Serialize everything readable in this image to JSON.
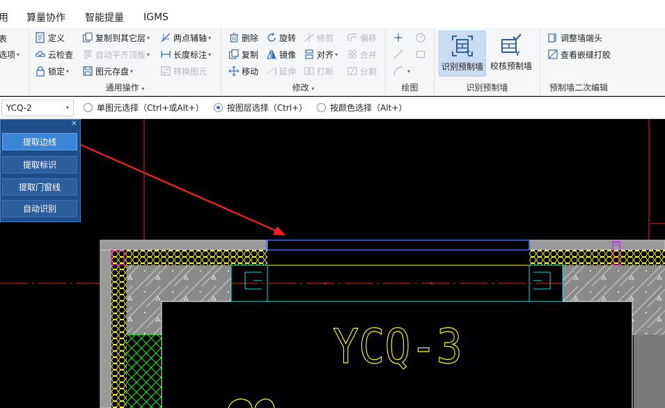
{
  "menubar": {
    "items": [
      "用",
      "算量协作",
      "智能提量",
      "IGMS"
    ]
  },
  "ribbon": {
    "left_partial": [
      {
        "label": "表"
      },
      {
        "label": "选项",
        "caret": true
      }
    ],
    "common_ops": {
      "title": "通用操作",
      "buttons": [
        {
          "label": "定义",
          "icon": "define-icon",
          "enabled": true
        },
        {
          "label": "云检查",
          "icon": "cloud-check-icon",
          "enabled": true
        },
        {
          "label": "锁定",
          "icon": "lock-icon",
          "enabled": true,
          "caret": true
        },
        {
          "label": "复制到其它层",
          "icon": "copy-layer-icon",
          "enabled": true,
          "caret": true
        },
        {
          "label": "自动平齐顶板",
          "icon": "align-top-icon",
          "enabled": false,
          "caret": true
        },
        {
          "label": "图元存盘",
          "icon": "save-element-icon",
          "enabled": true,
          "caret": true
        },
        {
          "label": "两点辅轴",
          "icon": "axis-icon",
          "enabled": true,
          "caret": true
        },
        {
          "label": "长度标注",
          "icon": "dimension-icon",
          "enabled": true,
          "caret": true
        },
        {
          "label": "转换图元",
          "icon": "convert-icon",
          "enabled": false
        }
      ]
    },
    "modify": {
      "title": "修改",
      "buttons": [
        {
          "label": "删除",
          "icon": "delete-icon",
          "enabled": true
        },
        {
          "label": "复制",
          "icon": "copy-icon",
          "enabled": true
        },
        {
          "label": "移动",
          "icon": "move-icon",
          "enabled": true
        },
        {
          "label": "旋转",
          "icon": "rotate-icon",
          "enabled": true
        },
        {
          "label": "镜像",
          "icon": "mirror-icon",
          "enabled": true
        },
        {
          "label": "延伸",
          "icon": "extend-icon",
          "enabled": false
        },
        {
          "label": "修剪",
          "icon": "trim-icon",
          "enabled": false
        },
        {
          "label": "对齐",
          "icon": "align-icon",
          "enabled": true,
          "caret": true
        },
        {
          "label": "打断",
          "icon": "break-icon",
          "enabled": false
        },
        {
          "label": "偏移",
          "icon": "offset-icon",
          "enabled": false
        },
        {
          "label": "合并",
          "icon": "merge-icon",
          "enabled": false
        },
        {
          "label": "分割",
          "icon": "split-icon",
          "enabled": false
        }
      ]
    },
    "draw": {
      "title": "绘图"
    },
    "recognize": {
      "title": "识别预制墙",
      "buttons": [
        {
          "label": "识别预制墙",
          "icon": "recognize-wall-icon",
          "active": true
        },
        {
          "label": "校核预制墙",
          "icon": "verify-wall-icon",
          "active": false
        }
      ]
    },
    "secondary": {
      "title": "预制墙二次编辑",
      "buttons": [
        {
          "label": "调整墙端头",
          "icon": "adjust-end-icon"
        },
        {
          "label": "查看嵌缝打胶",
          "icon": "view-seam-icon"
        }
      ]
    }
  },
  "selbar": {
    "layer_value": "YCQ-2",
    "options": [
      {
        "label": "单图元选择（Ctrl+或Alt+）",
        "checked": false
      },
      {
        "label": "按图层选择（Ctrl+）",
        "checked": true
      },
      {
        "label": "按颜色选择（Alt+）",
        "checked": false
      }
    ]
  },
  "panel": {
    "close": "×",
    "buttons": [
      {
        "label": "提取边线",
        "highlighted": true
      },
      {
        "label": "提取标识",
        "highlighted": false
      },
      {
        "label": "提取门窗线",
        "highlighted": false
      },
      {
        "label": "自动识别",
        "highlighted": false
      }
    ]
  },
  "canvas": {
    "drawing_label": "YCQ-3"
  },
  "colors": {
    "ribbon_bg": "#f5f6f8",
    "active_btn": "#c9dcf2",
    "panel_bg": "#1e4d8c",
    "panel_btn_hi": "#3c84d6",
    "cad_yellow": "#ffff00",
    "cad_red": "#ff2020",
    "cad_cyan": "#00e5e5",
    "cad_green": "#00ff00",
    "cad_magenta": "#ff00ff",
    "cad_blue": "#3a6cff"
  }
}
